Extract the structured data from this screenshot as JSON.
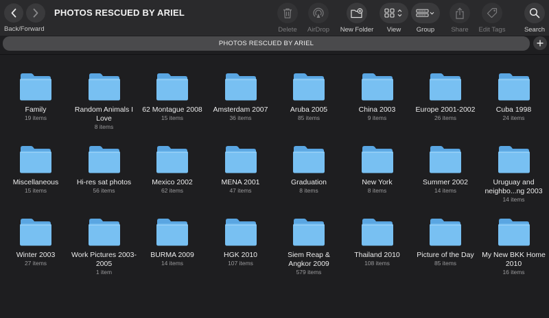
{
  "window": {
    "title": "PHOTOS RESCUED BY ARIEL"
  },
  "toolbar": {
    "nav_label": "Back/Forward",
    "delete": "Delete",
    "airdrop": "AirDrop",
    "new_folder": "New Folder",
    "view": "View",
    "group": "Group",
    "share": "Share",
    "edit_tags": "Edit Tags",
    "search": "Search"
  },
  "pathbar": {
    "label": "PHOTOS RESCUED BY ARIEL"
  },
  "colors": {
    "folder_front": "#78c0f2",
    "folder_back": "#5aa6e2",
    "background": "#1e1e20",
    "toolbar": "#2a2a2c"
  },
  "folders": [
    {
      "name": "Family",
      "count": "19 items"
    },
    {
      "name": "Random Animals I Love",
      "count": "8 items"
    },
    {
      "name": "62 Montague 2008",
      "count": "15 items"
    },
    {
      "name": "Amsterdam 2007",
      "count": "36 items"
    },
    {
      "name": "Aruba 2005",
      "count": "85 items"
    },
    {
      "name": "China 2003",
      "count": "9 items"
    },
    {
      "name": "Europe 2001-2002",
      "count": "26 items"
    },
    {
      "name": "Cuba 1998",
      "count": "24 items"
    },
    {
      "name": "Miscellaneous",
      "count": "15 items"
    },
    {
      "name": "Hi-res sat photos",
      "count": "56 items"
    },
    {
      "name": "Mexico 2002",
      "count": "62 items"
    },
    {
      "name": "MENA 2001",
      "count": "47 items"
    },
    {
      "name": "Graduation",
      "count": "8 items"
    },
    {
      "name": "New York",
      "count": "8 items"
    },
    {
      "name": "Summer 2002",
      "count": "14 items"
    },
    {
      "name": "Uruguay and neighbo...ng 2003",
      "count": "14 items"
    },
    {
      "name": "Winter 2003",
      "count": "27 items"
    },
    {
      "name": "Work Pictures 2003-2005",
      "count": "1 item"
    },
    {
      "name": "BURMA 2009",
      "count": "14 items"
    },
    {
      "name": "HGK 2010",
      "count": "107 items"
    },
    {
      "name": "Siem Reap & Angkor 2009",
      "count": "579 items"
    },
    {
      "name": "Thailand 2010",
      "count": "108 items"
    },
    {
      "name": "Picture of the Day",
      "count": "85 items"
    },
    {
      "name": "My New BKK Home 2010",
      "count": "16 items"
    }
  ]
}
